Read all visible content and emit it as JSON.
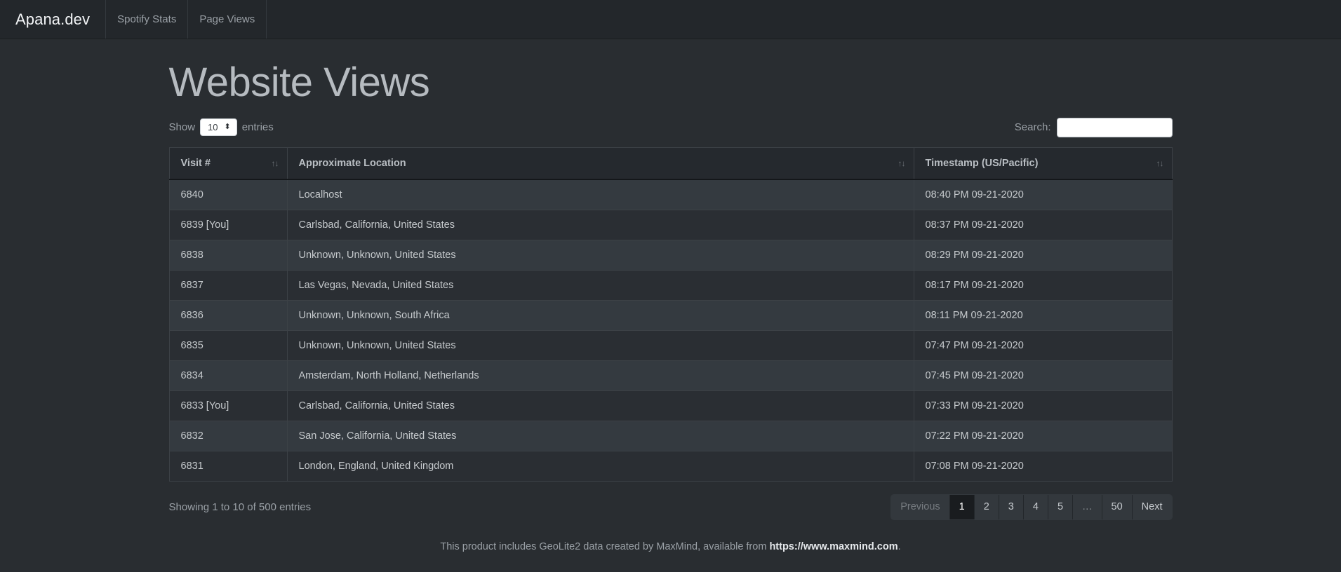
{
  "navbar": {
    "brand": "Apana.dev",
    "items": [
      {
        "label": "Spotify Stats"
      },
      {
        "label": "Page Views"
      }
    ]
  },
  "page": {
    "title": "Website Views"
  },
  "toolbar": {
    "show_label": "Show",
    "entries_label": "entries",
    "page_length_value": "10",
    "page_length_arrows": "⬍",
    "search_label": "Search:",
    "search_value": "",
    "search_placeholder": ""
  },
  "table": {
    "columns": [
      {
        "label": "Visit #",
        "sort": "↑↓"
      },
      {
        "label": "Approximate Location",
        "sort": "↑↓"
      },
      {
        "label": "Timestamp (US/Pacific)",
        "sort": "↑↓"
      }
    ],
    "rows": [
      {
        "visit": "6840",
        "location": "Localhost",
        "timestamp": "08:40 PM 09-21-2020"
      },
      {
        "visit": "6839 [You]",
        "location": "Carlsbad, California, United States",
        "timestamp": "08:37 PM 09-21-2020"
      },
      {
        "visit": "6838",
        "location": "Unknown, Unknown, United States",
        "timestamp": "08:29 PM 09-21-2020"
      },
      {
        "visit": "6837",
        "location": "Las Vegas, Nevada, United States",
        "timestamp": "08:17 PM 09-21-2020"
      },
      {
        "visit": "6836",
        "location": "Unknown, Unknown, South Africa",
        "timestamp": "08:11 PM 09-21-2020"
      },
      {
        "visit": "6835",
        "location": "Unknown, Unknown, United States",
        "timestamp": "07:47 PM 09-21-2020"
      },
      {
        "visit": "6834",
        "location": "Amsterdam, North Holland, Netherlands",
        "timestamp": "07:45 PM 09-21-2020"
      },
      {
        "visit": "6833 [You]",
        "location": "Carlsbad, California, United States",
        "timestamp": "07:33 PM 09-21-2020"
      },
      {
        "visit": "6832",
        "location": "San Jose, California, United States",
        "timestamp": "07:22 PM 09-21-2020"
      },
      {
        "visit": "6831",
        "location": "London, England, United Kingdom",
        "timestamp": "07:08 PM 09-21-2020"
      }
    ]
  },
  "table_footer": {
    "info": "Showing 1 to 10 of 500 entries",
    "pagination": [
      {
        "label": "Previous",
        "state": "disabled"
      },
      {
        "label": "1",
        "state": "active"
      },
      {
        "label": "2",
        "state": "normal"
      },
      {
        "label": "3",
        "state": "normal"
      },
      {
        "label": "4",
        "state": "normal"
      },
      {
        "label": "5",
        "state": "normal"
      },
      {
        "label": "…",
        "state": "ellipsis"
      },
      {
        "label": "50",
        "state": "normal"
      },
      {
        "label": "Next",
        "state": "normal"
      }
    ]
  },
  "site_footer": {
    "text_before": "This product includes GeoLite2 data created by MaxMind, available from ",
    "link": "https://www.maxmind.com",
    "text_after": "."
  },
  "colors": {
    "navbar_bg": "#23272b",
    "body_bg": "#292d31",
    "row_odd": "#343a40",
    "row_even": "#2a2e33",
    "header_bg": "#25292e",
    "active_page_bg": "#191c1f",
    "text": "#c8ccd0"
  }
}
